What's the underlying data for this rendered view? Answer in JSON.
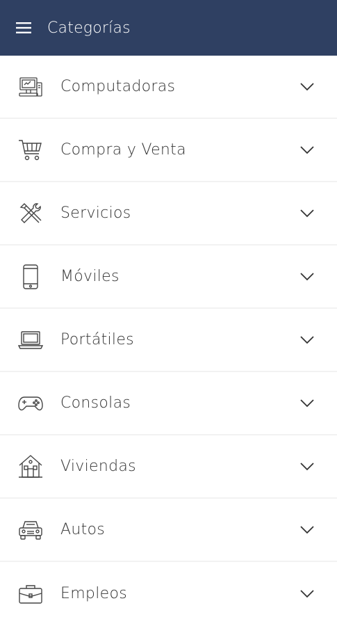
{
  "header": {
    "title": "Categorías",
    "menu_icon": "hamburger-menu-icon",
    "background": "#2f4062"
  },
  "categories": [
    {
      "label": "Computadoras",
      "icon": "desktop-computer-icon"
    },
    {
      "label": "Compra y Venta",
      "icon": "shopping-cart-icon"
    },
    {
      "label": "Servicios",
      "icon": "tools-icon"
    },
    {
      "label": "Móviles",
      "icon": "mobile-phone-icon"
    },
    {
      "label": "Portátiles",
      "icon": "laptop-icon"
    },
    {
      "label": "Consolas",
      "icon": "gamepad-icon"
    },
    {
      "label": "Viviendas",
      "icon": "house-icon"
    },
    {
      "label": "Autos",
      "icon": "car-icon"
    },
    {
      "label": "Empleos",
      "icon": "briefcase-icon"
    }
  ]
}
